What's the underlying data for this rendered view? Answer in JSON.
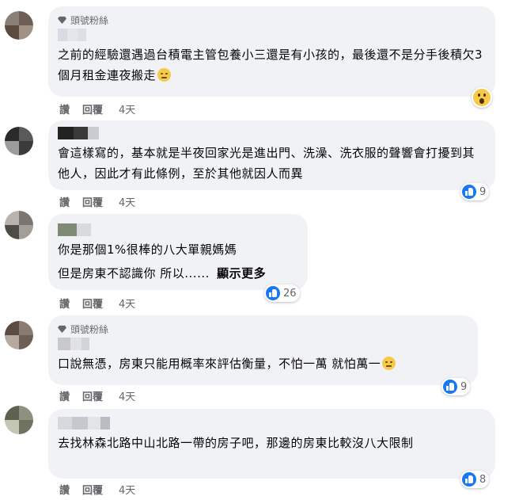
{
  "fan_badge_label": "頭號粉絲",
  "actions": {
    "like": "讚",
    "reply": "回覆"
  },
  "comments": [
    {
      "text": "之前的經驗還遇過台積電主管包養小三還是有小孩的，最後還不是分手後積欠3個月租金連夜搬走",
      "time": "4天",
      "reaction": "wow",
      "reaction_count": ""
    },
    {
      "text": "會這樣寫的，基本就是半夜回家光是進出門、洗澡、洗衣服的聲響會打擾到其他人，因此才有此條例，至於其他就因人而異",
      "time": "4天",
      "reaction": "like",
      "reaction_count": "9"
    },
    {
      "text_line1": "你是那個1%很棒的八大單親媽媽",
      "text_line2": "但是房東不認識你 所以......",
      "see_more": "顯示更多",
      "time": "4天",
      "reaction": "like",
      "reaction_count": "26"
    },
    {
      "text": "口說無憑，房東只能用概率來評估衡量，不怕一萬 就怕萬一",
      "time": "4天",
      "reaction": "like",
      "reaction_count": "9"
    },
    {
      "text": "去找林森北路中山北路一帶的房子吧，那邊的房東比較沒八大限制",
      "time": "4天",
      "reaction": "like",
      "reaction_count": "8"
    }
  ],
  "colors": {
    "bubble": "#f0f2f5",
    "meta": "#65676b",
    "like_blue": "#1877f2"
  }
}
